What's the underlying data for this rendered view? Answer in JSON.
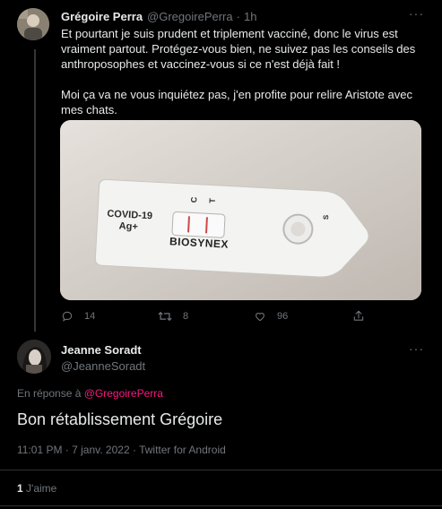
{
  "parent_tweet": {
    "display_name": "Grégoire Perra",
    "handle": "@GregoirePerra",
    "separator": "·",
    "time": "1h",
    "more": "···",
    "text_p1": "Et pourtant je suis prudent et triplement vacciné, donc le virus est vraiment partout. Protégez-vous bien, ne suivez pas les conseils des anthroposophes et vaccinez-vous si ce n'est déjà fait !",
    "text_p2": "Moi ça va ne vous inquiétez pas, j'en profite pour relire Aristote avec mes chats.",
    "media_test": {
      "brand": "BIOSYNEX",
      "label_line1": "COVID-19",
      "label_line2": "Ag+",
      "mark_c": "C",
      "mark_t": "T",
      "mark_s": "S"
    },
    "actions": {
      "replies": "14",
      "retweets": "8",
      "likes": "96"
    }
  },
  "reply_tweet": {
    "display_name": "Jeanne Soradt",
    "handle": "@JeanneSoradt",
    "more": "···",
    "in_reply_prefix": "En réponse à",
    "in_reply_handle": "@GregoirePerra",
    "text": "Bon rétablissement Grégoire",
    "meta": "11:01 PM · 7 janv. 2022 · Twitter for Android",
    "likes_count": "1",
    "likes_label": "J'aime"
  },
  "colors": {
    "background": "#000000",
    "text": "#e7e9ea",
    "muted": "#71767b",
    "mention": "#f91880",
    "divider": "#2f3336"
  }
}
